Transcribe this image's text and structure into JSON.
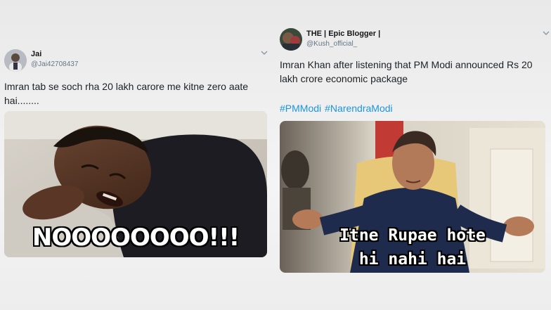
{
  "tweet_left": {
    "name": "Jai",
    "handle": "@Jai42708437",
    "text": "Imran tab se soch rha 20 lakh carore me kitne zero aate hai........",
    "meme_caption": "NOOOOOOOO!!!",
    "menu_icon": "chevron-down-icon"
  },
  "tweet_right": {
    "name": "THE | Epic Blogger |",
    "handle": "@Kush_official_",
    "text": "Imran Khan after listening  that PM Modi announced Rs 20 lakh crore economic package",
    "hashtags": [
      "#PMModi",
      "#NarendraModi"
    ],
    "meme_caption_line1": "Itne Rupae hote",
    "meme_caption_line2": "hi nahi hai",
    "menu_icon": "chevron-down-icon"
  },
  "colors": {
    "link": "#1b95e0",
    "text": "#14171a",
    "handle": "#657786"
  }
}
